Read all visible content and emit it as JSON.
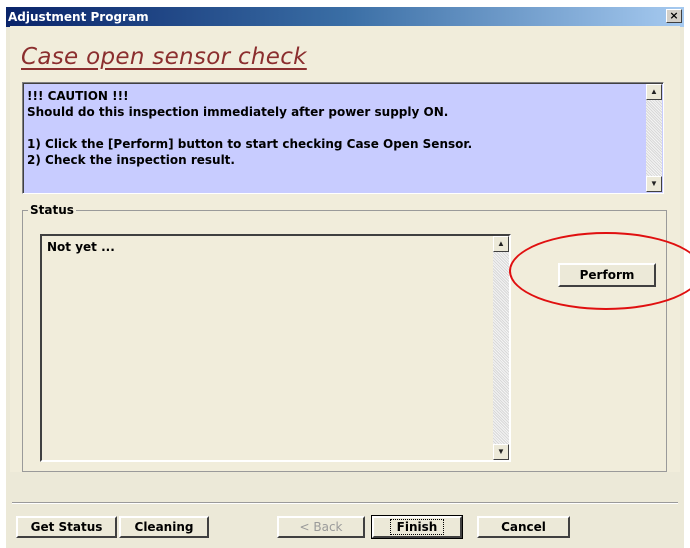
{
  "window": {
    "title": "Adjustment Program",
    "close_label": "×"
  },
  "heading": "Case open sensor check",
  "caution": {
    "text": "!!! CAUTION !!!\nShould do this inspection immediately after power supply ON.\n\n1) Click the [Perform] button to start checking Case Open Sensor.\n2) Check the inspection result."
  },
  "status": {
    "group_label": "Status",
    "text": "Not yet ...",
    "perform_label": "Perform"
  },
  "footer": {
    "get_status_label": "Get Status",
    "cleaning_label": "Cleaning",
    "back_label": "< Back",
    "finish_label": "Finish",
    "cancel_label": "Cancel"
  },
  "colors": {
    "heading": "#8B2E2E",
    "caution_bg": "#C8CCFF",
    "highlight_circle": "#E01010"
  }
}
